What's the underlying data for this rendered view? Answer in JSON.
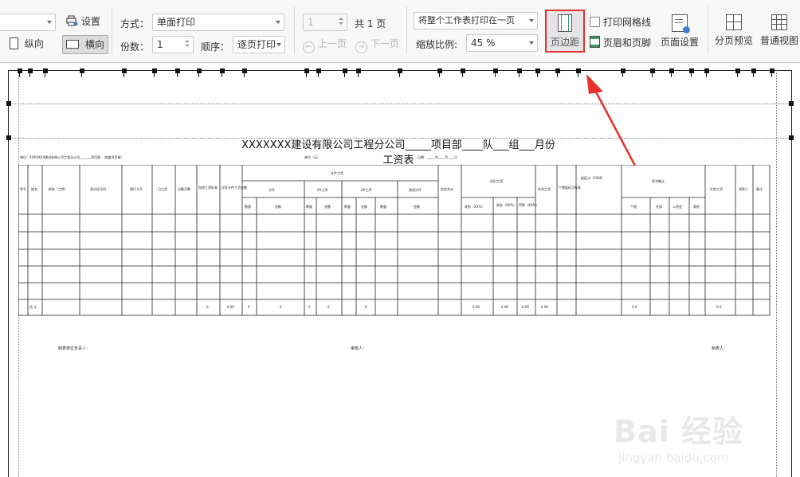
{
  "toolbar": {
    "setup_label": "设置",
    "portrait_label": "纵向",
    "landscape_label": "横向",
    "mode_label": "方式：",
    "mode_value": "单面打印",
    "copies_label": "份数：",
    "copies_value": "1",
    "order_label": "顺序：",
    "order_value": "逐页打印",
    "page_value": "1",
    "total_pages": "共 1 页",
    "prev_page": "上一页",
    "next_page": "下一页",
    "scale_mode_value": "将整个工作表打印在一页",
    "zoom_label": "缩放比例:",
    "zoom_value": "45 %",
    "margins_label": "页边距",
    "print_gridlines_label": "打印网格线",
    "header_footer_label": "页眉和页脚",
    "page_setup_label": "页面设置",
    "page_break_preview_label": "分页预览",
    "normal_view_label": "普通视图"
  },
  "sheet": {
    "title": "XXXXXXX建设有限公司工程分公司_____项目部____队___组___月份工资表",
    "unit_text": "单位：XXXXXXX建设有限公司工程分公司_______项目部  （加盖项目章）",
    "currency_text": "单位（元）",
    "date_text": "日期：_____年____月____日",
    "headers": {
      "seq": "序号",
      "name": "姓名",
      "job": "职务（工种）",
      "id_no": "身份证号码",
      "bank": "银行卡号",
      "wage_day": "日工资",
      "attendance": "出勤天数",
      "overtime": "加班工资标准",
      "should_pay": "应发计件工资金额",
      "piece_group": "计件工资",
      "piece1": "计件",
      "piece2": "XX工序",
      "piece3": "XX工序",
      "piece4": "其他计件",
      "qty": "数量",
      "amount": "金额",
      "total_pay": "应发合计",
      "deduct_group": "应扣工资",
      "deduct1": "其他（XX%）",
      "deduct2": "借支（XX%）",
      "deduct3": "罚款（XX%）",
      "real_pay": "实发工资",
      "tax_basis": "个税起征点标准",
      "tax_note": "起征点（5000）",
      "sign_group": "签字确认",
      "sign1": "个税",
      "sign2": "社保",
      "sign3": "公积金",
      "sign4": "其他",
      "actual": "实发工资",
      "receiver": "领款人",
      "remark": "备注"
    },
    "total_label": "合 计",
    "total_values": [
      "0",
      "0.00",
      "0",
      "0",
      "0",
      "0",
      "0",
      "0.00",
      "0.00",
      "0.00",
      "0.00",
      "0.0",
      "0.0"
    ],
    "footer_preparer": "制表单位负责人：",
    "footer_reviewer": "审核人：",
    "footer_maker": "制表人："
  },
  "watermark": {
    "logo": "Bai 经验",
    "url": "jingyan.baidu.com"
  }
}
